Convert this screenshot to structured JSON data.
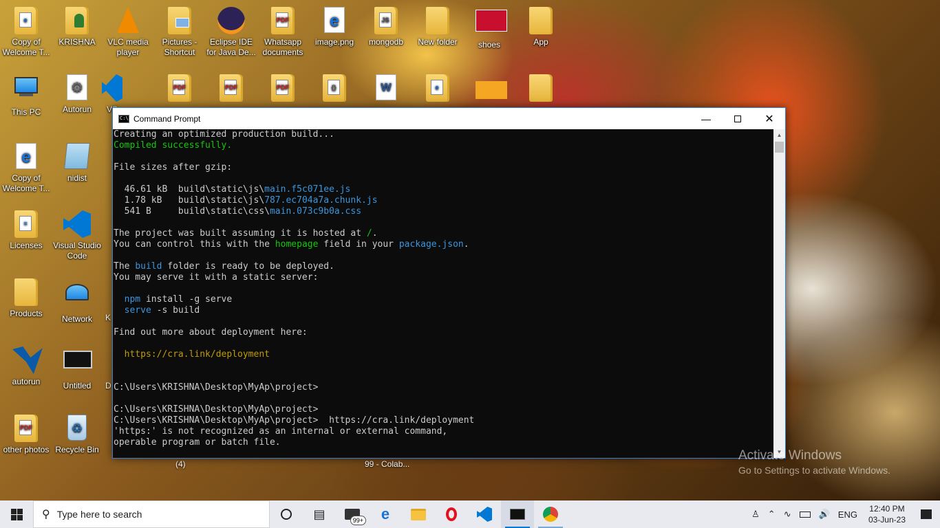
{
  "desktop": {
    "icons": [
      {
        "label": "Copy of Welcome T...",
        "icon": "edge-doc-icon"
      },
      {
        "label": "KRISHNA",
        "icon": "user-folder-icon"
      },
      {
        "label": "VLC media player",
        "icon": "vlc-icon"
      },
      {
        "label": "Pictures - Shortcut",
        "icon": "pictures-folder-icon"
      },
      {
        "label": "Eclipse IDE for Java De...",
        "icon": "eclipse-icon"
      },
      {
        "label": "Whatsapp documents",
        "icon": "pdf-folder-icon"
      },
      {
        "label": "image.png",
        "icon": "image-icon"
      },
      {
        "label": "mongodb",
        "icon": "js-folder-icon"
      },
      {
        "label": "New folder",
        "icon": "folder-icon"
      },
      {
        "label": "shoes",
        "icon": "shoes-image-icon"
      },
      {
        "label": "App",
        "icon": "folder-icon"
      },
      {
        "label": "This PC",
        "icon": "computer-icon"
      },
      {
        "label": "Autorun",
        "icon": "settings-file-icon"
      },
      {
        "label": "VS",
        "icon": "vscode-icon"
      },
      {
        "label": "Copy of Welcome T...",
        "icon": "edge-doc-icon"
      },
      {
        "label": "nidist",
        "icon": "notepad-icon"
      },
      {
        "label": "Licenses",
        "icon": "doc-folder-icon"
      },
      {
        "label": "Visual Studio Code",
        "icon": "vscode-icon"
      },
      {
        "label": "Products",
        "icon": "folder-icon"
      },
      {
        "label": "Network",
        "icon": "network-icon"
      },
      {
        "label": "autorun",
        "icon": "autorun-icon"
      },
      {
        "label": "Untitled",
        "icon": "terminal-icon"
      },
      {
        "label": "other photos",
        "icon": "pdf-folder-icon"
      },
      {
        "label": "Recycle Bin",
        "icon": "recycle-bin-icon"
      }
    ],
    "stray_labels": {
      "k": "K",
      "d": "D",
      "four": "(4)",
      "colab": "99 - Colab..."
    }
  },
  "cmd": {
    "title": "Command Prompt",
    "lines": {
      "l1": "Creating an optimized production build...",
      "l2": "Compiled successfully.",
      "l3": "File sizes after gzip:",
      "s1_size": "  46.61 kB  ",
      "s1_path": "build\\static\\js\\",
      "s1_file": "main.f5c071ee.js",
      "s2_size": "  1.78 kB   ",
      "s2_path": "build\\static\\js\\",
      "s2_file": "787.ec704a7a.chunk.js",
      "s3_size": "  541 B     ",
      "s3_path": "build\\static\\css\\",
      "s3_file": "main.073c9b0a.css",
      "h1a": "The project was built assuming it is hosted at ",
      "h1b": "/",
      "h1c": ".",
      "h2a": "You can control this with the ",
      "h2b": "homepage",
      "h2c": " field in your ",
      "h2d": "package.json",
      "h2e": ".",
      "b1a": "The ",
      "b1b": "build",
      "b1c": " folder is ready to be deployed.",
      "b2": "You may serve it with a static server:",
      "n1a": "  ",
      "n1b": "npm",
      "n1c": " install -g serve",
      "n2a": "  ",
      "n2b": "serve",
      "n2c": " -s build",
      "f1": "Find out more about deployment here:",
      "f2": "  https://cra.link/deployment",
      "p1": "C:\\Users\\KRISHNA\\Desktop\\MyAp\\project>",
      "p2": "C:\\Users\\KRISHNA\\Desktop\\MyAp\\project>",
      "p3": "C:\\Users\\KRISHNA\\Desktop\\MyAp\\project>  https://cra.link/deployment",
      "e1": "'https:' is not recognized as an internal or external command,",
      "e2": "operable program or batch file."
    }
  },
  "watermark": {
    "line1": "Activate Windows",
    "line2": "Go to Settings to activate Windows."
  },
  "taskbar": {
    "search_placeholder": "Type here to search",
    "mail_badge": "99+",
    "language": "ENG",
    "time": "12:40 PM",
    "date": "03-Jun-23"
  }
}
